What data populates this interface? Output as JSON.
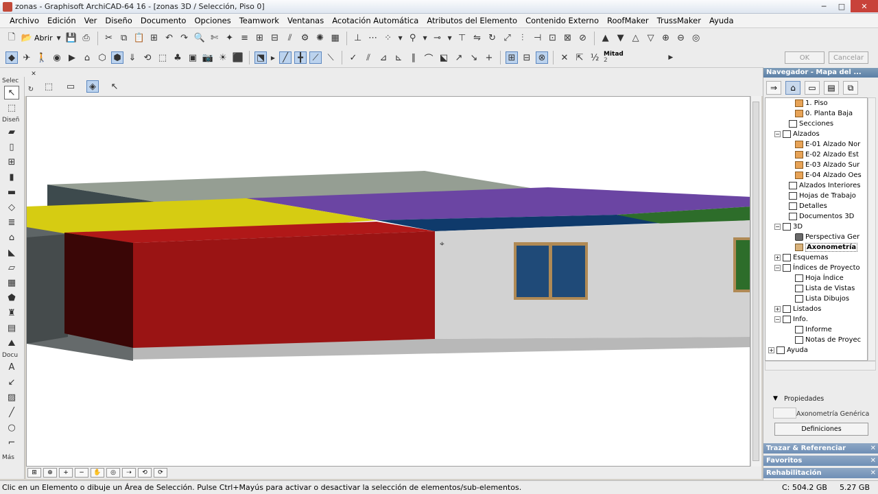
{
  "window": {
    "title": "zonas - Graphisoft ArchiCAD-64 16 - [zonas 3D / Selección, Piso 0]",
    "controls": [
      "─",
      "□",
      "✕"
    ]
  },
  "menu": [
    "Archivo",
    "Edición",
    "Ver",
    "Diseño",
    "Documento",
    "Opciones",
    "Teamwork",
    "Ventanas",
    "Acotación Automática",
    "Atributos del Elemento",
    "Contenido Externo",
    "RoofMaker",
    "TrussMaker",
    "Ayuda"
  ],
  "toolbar": {
    "open_label": "Abrir",
    "half_label": "Mitad",
    "half_sub": "2",
    "ok_label": "OK",
    "cancel_label": "Cancelar"
  },
  "toolbox": {
    "captions": {
      "select": "Selec",
      "design": "Diseñ",
      "document": "Docu",
      "more": "Más"
    }
  },
  "navigator": {
    "title": "Navegador - Mapa del ...",
    "tree": [
      {
        "indent": 3,
        "expander": "",
        "icon": "house",
        "label": "1. Piso"
      },
      {
        "indent": 3,
        "expander": "",
        "icon": "house",
        "label": "0. Planta Baja"
      },
      {
        "indent": 2,
        "expander": "",
        "icon": "doc",
        "label": "Secciones"
      },
      {
        "indent": 1,
        "expander": "−",
        "icon": "doc",
        "label": "Alzados"
      },
      {
        "indent": 3,
        "expander": "",
        "icon": "house",
        "label": "E-01 Alzado Nor"
      },
      {
        "indent": 3,
        "expander": "",
        "icon": "house",
        "label": "E-02 Alzado Est"
      },
      {
        "indent": 3,
        "expander": "",
        "icon": "house",
        "label": "E-03 Alzado Sur"
      },
      {
        "indent": 3,
        "expander": "",
        "icon": "house",
        "label": "E-04 Alzado Oes"
      },
      {
        "indent": 2,
        "expander": "",
        "icon": "doc",
        "label": "Alzados Interiores"
      },
      {
        "indent": 2,
        "expander": "",
        "icon": "doc",
        "label": "Hojas de Trabajo"
      },
      {
        "indent": 2,
        "expander": "",
        "icon": "doc",
        "label": "Detalles"
      },
      {
        "indent": 2,
        "expander": "",
        "icon": "doc",
        "label": "Documentos 3D"
      },
      {
        "indent": 1,
        "expander": "−",
        "icon": "doc",
        "label": "3D"
      },
      {
        "indent": 3,
        "expander": "",
        "icon": "cam",
        "label": "Perspectiva Ger"
      },
      {
        "indent": 3,
        "expander": "",
        "icon": "cube",
        "label": "Axonometría",
        "selected": true
      },
      {
        "indent": 1,
        "expander": "+",
        "icon": "doc",
        "label": "Esquemas"
      },
      {
        "indent": 1,
        "expander": "−",
        "icon": "doc",
        "label": "Índices de Proyecto"
      },
      {
        "indent": 3,
        "expander": "",
        "icon": "doc",
        "label": "Hoja Índice"
      },
      {
        "indent": 3,
        "expander": "",
        "icon": "doc",
        "label": "Lista de Vistas"
      },
      {
        "indent": 3,
        "expander": "",
        "icon": "doc",
        "label": "Lista Dibujos"
      },
      {
        "indent": 1,
        "expander": "+",
        "icon": "doc",
        "label": "Listados"
      },
      {
        "indent": 1,
        "expander": "−",
        "icon": "doc",
        "label": "Info."
      },
      {
        "indent": 3,
        "expander": "",
        "icon": "doc",
        "label": "Informe"
      },
      {
        "indent": 3,
        "expander": "",
        "icon": "doc",
        "label": "Notas de Proyec"
      },
      {
        "indent": 0,
        "expander": "+",
        "icon": "doc",
        "label": "Ayuda"
      }
    ],
    "properties_label": "Propiedades",
    "property_value": "Axonometría Genérica",
    "settings_button": "Definiciones",
    "panels": [
      "Trazar & Referenciar",
      "Favoritos",
      "Rehabilitación"
    ]
  },
  "status": {
    "message": "Clic en un Elemento o dibuje un Área de Selección. Pulse Ctrl+Mayús para activar o desactivar la selección de elementos/sub-elementos.",
    "disk_c": "C: 504.2 GB",
    "disk_free": "5.27 GB"
  },
  "colors": {
    "zone_red": "#9a1414",
    "zone_yellow": "#d6cc12",
    "zone_purple": "#6b45a3",
    "zone_navy": "#0f3a6b",
    "zone_green": "#2d6d2a",
    "zone_gray": "#959e93",
    "wall": "#d2d2d2",
    "window_frame": "#b08a55",
    "window_glass": "#1f4a78"
  }
}
